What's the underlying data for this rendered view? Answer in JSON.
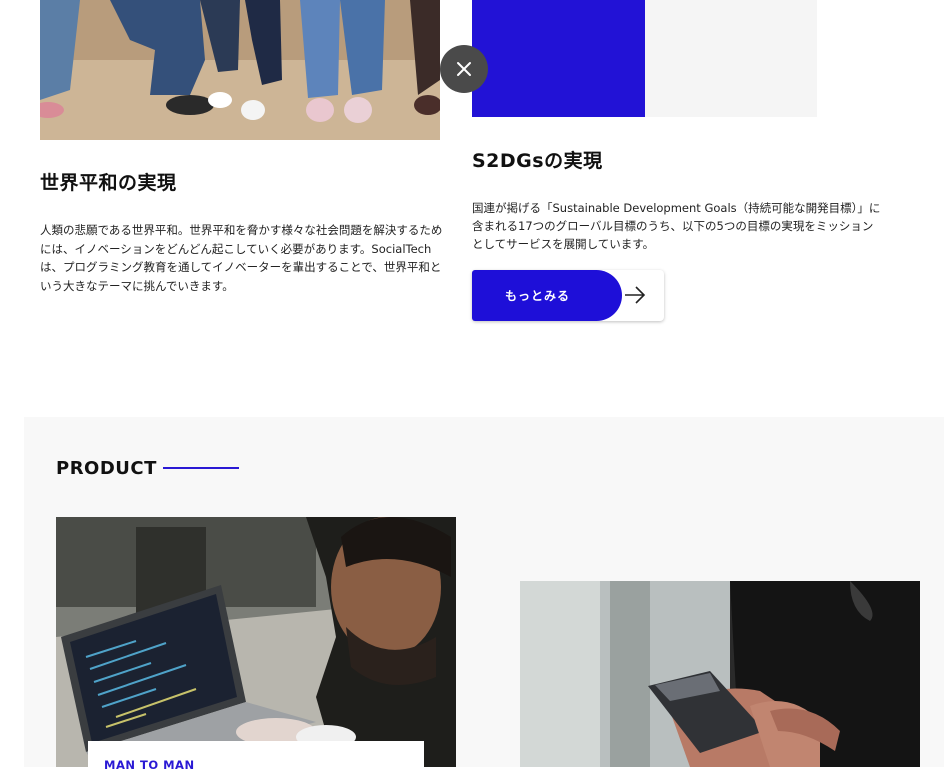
{
  "close_button": {
    "icon": "close-icon"
  },
  "mission_world": {
    "title": "世界平和の実現",
    "body": "人類の悲願である世界平和。世界平和を脅かす様々な社会問題を解決するためには、イノベーションをどんどん起こしていく必要があります。SocialTechは、プログラミング教育を通してイノベーターを輩出することで、世界平和という大きなテーマに挑んでいきます。"
  },
  "mission_s2dgs": {
    "title": "S2DGsの実現",
    "body": "国連が掲げる「Sustainable Development Goals（持続可能な開発目標）」に含まれる17つのグローバル目標のうち、以下の5つの目標の実現をミッションとしてサービスを展開しています。",
    "button_label": "もっとみる",
    "button_icon": "arrow-right-icon",
    "accent_color": "#1e0fd8"
  },
  "product": {
    "title": "PRODUCT",
    "cards": [
      {
        "tag": "MAN TO MAN"
      }
    ]
  }
}
